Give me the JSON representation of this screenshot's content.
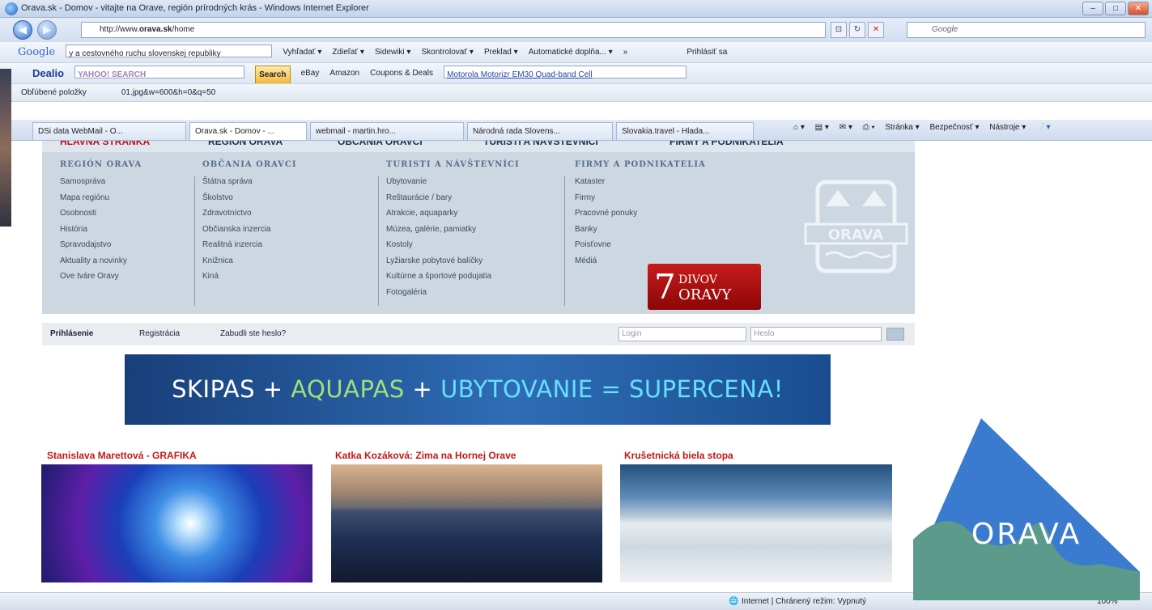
{
  "window": {
    "title": "Orava.sk - Domov - vitajte na Orave, región prírodných krás - Windows Internet Explorer"
  },
  "address": {
    "url_prefix": "http://www.",
    "url_bold": "orava.sk",
    "url_suffix": "/home",
    "search_placeholder": "Google"
  },
  "google_toolbar": {
    "brand": "Google",
    "query": "y a cestovného ruchu slovenskej republiky",
    "items": [
      "Vyhľadať ▾",
      "Zdieľať ▾",
      "Sidewiki ▾",
      "Skontrolovať ▾",
      "Preklad ▾",
      "Automatické doplňa... ▾",
      "»",
      "Prihlásiť sa"
    ]
  },
  "dealio_toolbar": {
    "brand": "Dealio",
    "search_box": "YAHOO! SEARCH",
    "search_button": "Search",
    "items": [
      "eBay",
      "Amazon",
      "Coupons & Deals"
    ],
    "link": "Motorola Motorizr EM30 Quad-band Cell"
  },
  "favorites": {
    "label": "Obľúbené položky",
    "item": "01.jpg&w=600&h=0&q=50"
  },
  "tabs": [
    "DSi data WebMail - O...",
    "Orava.sk - Domov - ...",
    "webmail - martin.hro...",
    "Národná rada Slovens...",
    "Slovakia.travel - Hlada..."
  ],
  "commandbar": [
    "Stránka ▾",
    "Bezpečnosť ▾",
    "Nástroje ▾"
  ],
  "mainnav": [
    "HLAVNÁ STRÁNKA",
    "REGIÓN ORAVA",
    "OBČANIA ORAVCI",
    "TURISTI A NÁVŠTEVNÍCI",
    "FIRMY A PODNIKATELIA"
  ],
  "menu": {
    "col1": {
      "title": "REGIÓN ORAVA",
      "items": [
        "Samospráva",
        "Mapa regiónu",
        "Osobnosti",
        "História",
        "Spravodajstvo",
        "Aktuality a novinky",
        "Ove tváre Oravy"
      ]
    },
    "col2": {
      "title": "OBČANIA ORAVCI",
      "items": [
        "Štátna správa",
        "Školstvo",
        "Zdravotníctvo",
        "Občianska inzercia",
        "Realitná inzercia",
        "Knižnica",
        "Kiná"
      ]
    },
    "col3": {
      "title": "TURISTI A NÁVŠTEVNÍCI",
      "items": [
        "Ubytovanie",
        "Reštaurácie / bary",
        "Atrakcie, aquaparky",
        "Múzea, galérie, pamiatky",
        "Kostoly",
        "Lyžiarske pobytové balíčky",
        "Kultúrne a športové podujatia",
        "Fotogaléria"
      ]
    },
    "col4": {
      "title": "FIRMY A PODNIKATELIA",
      "items": [
        "Kataster",
        "Firmy",
        "Pracovné ponuky",
        "Banky",
        "Poisťovne",
        "Médiá"
      ]
    },
    "emblem_text": "ORAVA"
  },
  "sedem_divov": {
    "number": "7",
    "word1": "DIVOV",
    "word2": "ORAVY"
  },
  "login": {
    "login_label": "Prihlásenie",
    "register": "Registrácia",
    "forgot": "Zabudli ste heslo?",
    "login_placeholder": "Login",
    "password_placeholder": "Heslo"
  },
  "banner": {
    "part1": "SKIPAS + ",
    "part2": "AQUAPAS",
    "part3": " + ",
    "part4": "UBYTOVANIE = SUPERCENA!"
  },
  "articles": [
    {
      "title": "Stanislava Marettová - GRAFIKA"
    },
    {
      "title": "Katka Kozáková: Zima na Hornej Orave"
    },
    {
      "title": "Krušetnická biela stopa"
    }
  ],
  "status": {
    "zone": "Internet | Chránený režim: Vypnutý",
    "zoom": "100%"
  },
  "logo": {
    "text": "ORAVA",
    "colors": {
      "mountain": "#3a7bd0",
      "hill": "#5c9a8b"
    }
  }
}
